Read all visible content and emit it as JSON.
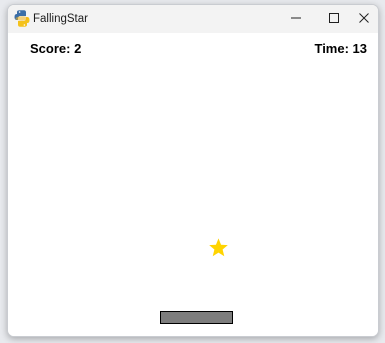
{
  "window": {
    "title": "FallingStar",
    "icon": "python-icon",
    "controls": {
      "minimize": "minimize-icon",
      "maximize": "maximize-icon",
      "close": "close-icon"
    }
  },
  "hud": {
    "score_label": "Score: 2",
    "time_label": "Time: 13"
  },
  "game": {
    "star_icon": "star-icon",
    "star_color": "#ffd400",
    "paddle_color": "#7d7d7d",
    "paddle_border_color": "#000000",
    "background_color": "#ffffff"
  }
}
